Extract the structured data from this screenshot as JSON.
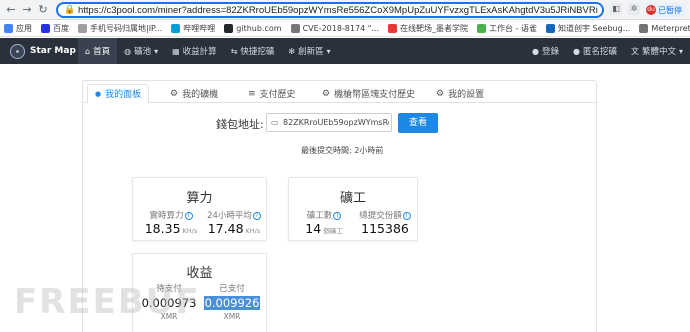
{
  "browser": {
    "url": "https://c3pool.com/miner?address=82ZKRroUEb59opzWYmsRe556ZCoX9MpUpZuUYFvzxgTLExAsKAhgtdV3u5JRiNBVRi5sPFwoECTI",
    "profile_label": "已暂停",
    "profile_initials": "du"
  },
  "bookmarks": [
    {
      "label": "应用",
      "color": "#4285f4"
    },
    {
      "label": "百度",
      "color": "#2932e1"
    },
    {
      "label": "手机号码归属地|IP...",
      "color": "#9e9e9e"
    },
    {
      "label": "哔哩哔哩",
      "color": "#00a1d6"
    },
    {
      "label": "github.com",
      "color": "#24292e"
    },
    {
      "label": "CVE-2018-8174 \"...",
      "color": "#777777"
    },
    {
      "label": "在线靶场_墨者学院",
      "color": "#e53935"
    },
    {
      "label": "工作台 - 语雀",
      "color": "#4caf50"
    },
    {
      "label": "知道创宇 Seebug...",
      "color": "#1565c0"
    },
    {
      "label": "Meterpreter命令...",
      "color": "#757575"
    }
  ],
  "navbar": {
    "brand": "Star Map",
    "items": [
      {
        "label": "首頁",
        "icon": "home-icon",
        "glyph": "⌂"
      },
      {
        "label": "礦池",
        "icon": "globe-icon",
        "glyph": "◍"
      },
      {
        "label": "收益計算",
        "icon": "calculator-icon",
        "glyph": "▦"
      },
      {
        "label": "快捷挖礦",
        "icon": "link-icon",
        "glyph": "⇆"
      },
      {
        "label": "創新區",
        "icon": "gear-icon",
        "glyph": "✻"
      }
    ],
    "right": [
      {
        "label": "登錄",
        "icon": "user-icon",
        "glyph": "●"
      },
      {
        "label": "匿名挖礦",
        "icon": "user-secret-icon",
        "glyph": "●"
      },
      {
        "label": "繁體中文",
        "icon": "translate-icon",
        "glyph": "文"
      }
    ]
  },
  "tabs": [
    {
      "label": "我的面板",
      "icon": "user-icon",
      "glyph": "●"
    },
    {
      "label": "我的礦機",
      "icon": "gear-icon",
      "glyph": "⚙"
    },
    {
      "label": "支付歷史",
      "icon": "list-icon",
      "glyph": "≡"
    },
    {
      "label": "機槍幣區塊支付歷史",
      "icon": "gear-icon",
      "glyph": "⚙"
    },
    {
      "label": "我的設置",
      "icon": "settings-icon",
      "glyph": "⚙"
    }
  ],
  "wallet": {
    "label": "錢包地址:",
    "value": "82ZKRroUEb59opzWYmsRe5",
    "search_label": "查看",
    "last_submit": "最後提交時間: 2小時前"
  },
  "hashrate": {
    "title": "算力",
    "realtime_label": "實時算力",
    "realtime_value": "18.35",
    "avg_label": "24小時平均",
    "avg_value": "17.48",
    "unit": "KH/s"
  },
  "workers": {
    "title": "礦工",
    "count_label": "礦工數",
    "count_value": "14",
    "count_unit": "個礦工",
    "shares_label": "總提交份額",
    "shares_value": "115386"
  },
  "earnings": {
    "title": "收益",
    "pending_label": "待支付",
    "pending_value": "0.000973",
    "paid_label": "已支付",
    "paid_value": "0.009926",
    "currency": "XMR"
  },
  "watermark": "FREEBUF"
}
